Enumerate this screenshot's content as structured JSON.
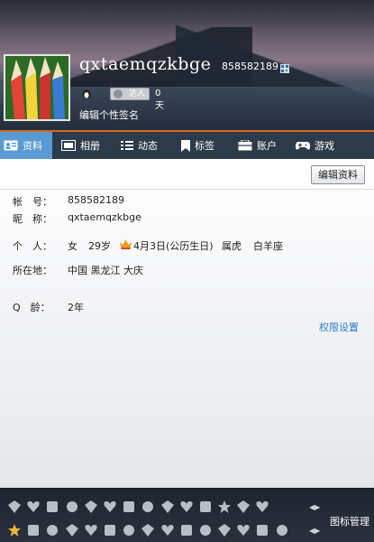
{
  "profile": {
    "nickname": "qxtaemqzkbge",
    "qq_number": "858582189",
    "badge_label": "达人",
    "active_days": "0天",
    "signature_placeholder": "编辑个性签名"
  },
  "tabs": [
    {
      "label": "资料",
      "icon": "profile-card-icon",
      "active": true
    },
    {
      "label": "相册",
      "icon": "photo-album-icon",
      "active": false
    },
    {
      "label": "动态",
      "icon": "feed-list-icon",
      "active": false
    },
    {
      "label": "标签",
      "icon": "bookmark-tag-icon",
      "active": false
    },
    {
      "label": "账户",
      "icon": "wallet-icon",
      "active": false
    },
    {
      "label": "游戏",
      "icon": "game-controller-icon",
      "active": false
    }
  ],
  "toolbar": {
    "edit_label": "编辑资料"
  },
  "details": {
    "account_label": "帐　号：",
    "account_value": "858582189",
    "nickname_label": "昵　称：",
    "nickname_value": "qxtaemqzkbge",
    "personal_label": "个　人：",
    "gender": "女",
    "age": "29岁",
    "birthday": "4月3日(公历生日)",
    "zodiac": "属虎",
    "constellation": "白羊座",
    "location_label": "所在地：",
    "location": "中国 黑龙江 大庆",
    "qage_label": "Q　龄：",
    "qage_value": "2年"
  },
  "permissions_link": "权限设置",
  "iconbar": {
    "manage_label": "图标管理",
    "row1_icons": [
      "mobile-qq-icon",
      "heart-icon",
      "qq-penguin-icon",
      "flag-icon",
      "diamond-icon",
      "vip-icon",
      "diamond-icon",
      "diamond-icon",
      "diamond-icon",
      "diamond-icon",
      "diamond-icon",
      "star-badge-icon",
      "diamond-icon",
      "heart-icon"
    ],
    "row2_icons": [
      "gold-star-icon",
      "app-icon",
      "camera-icon",
      "game-icon",
      "shield-icon",
      "music-icon",
      "gift-icon",
      "photo-icon",
      "night-icon",
      "pet-icon",
      "safe-icon",
      "qq-music-icon",
      "edit-icon",
      "mail-icon",
      "video-icon"
    ],
    "accent_color": "#e8b83a"
  },
  "colors": {
    "active_tab": "#5a9ad3",
    "tab_bar": "#2d3a4a",
    "accent_line": "#d06a20",
    "link": "#2b7bd0"
  }
}
